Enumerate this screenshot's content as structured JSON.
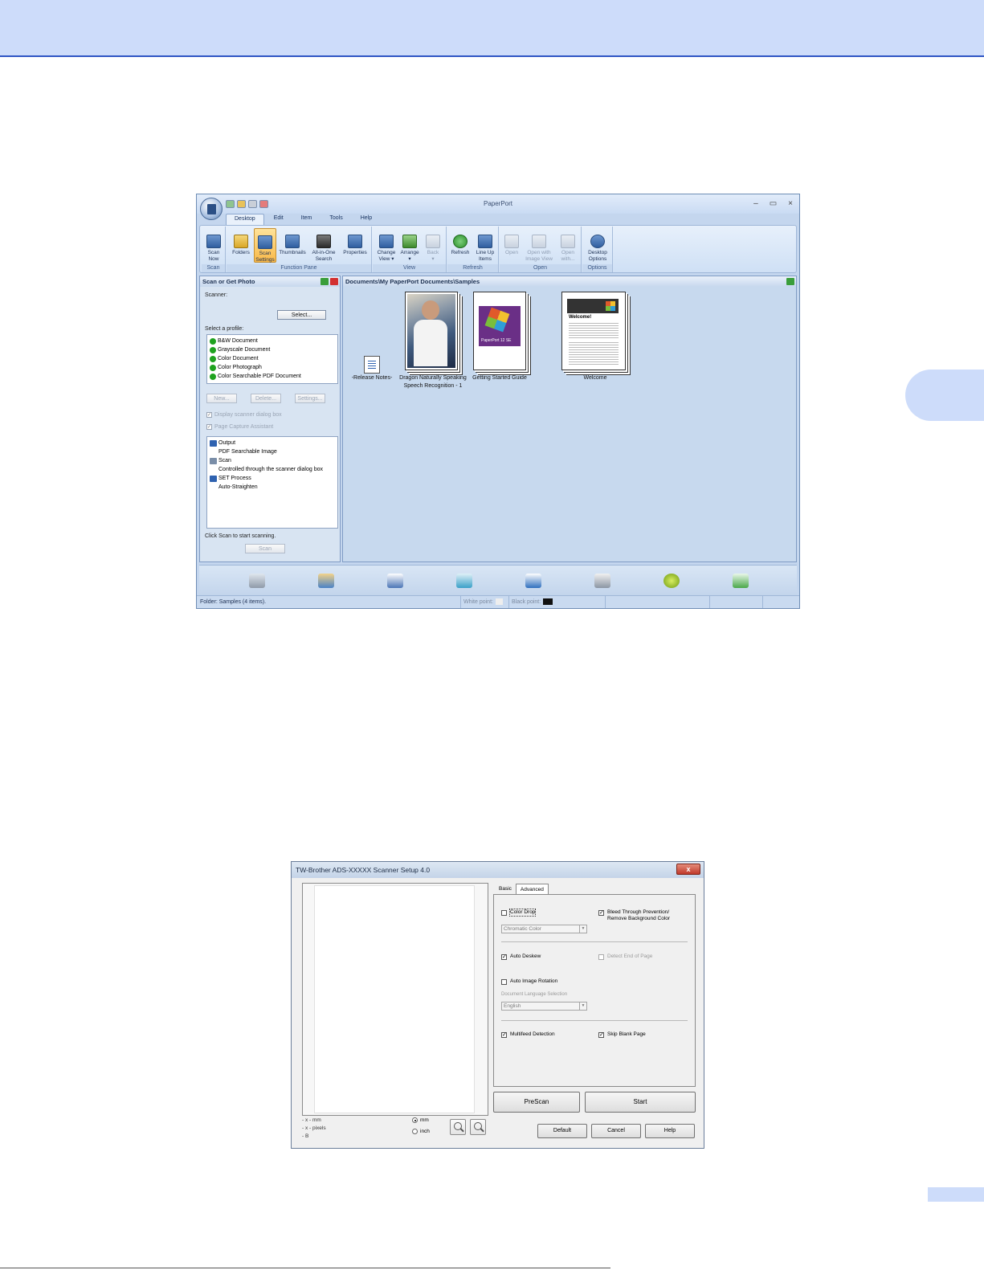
{
  "paperport": {
    "title": "PaperPort",
    "window_controls": [
      "–",
      "▭",
      "×"
    ],
    "tabs": [
      {
        "label": "Desktop",
        "active": true
      },
      {
        "label": "Edit"
      },
      {
        "label": "Item"
      },
      {
        "label": "Tools"
      },
      {
        "label": "Help"
      }
    ],
    "ribbon": {
      "scan_now": "Scan\nNow",
      "folders": "Folders",
      "scan_settings": "Scan\nSettings",
      "thumbnails": "Thumbnails",
      "all_in_one_search": "All-in-One\nSearch",
      "properties": "Properties",
      "change_view": "Change\nView ▾",
      "arrange": "Arrange\n▾",
      "back": "Back\n▾",
      "refresh": "Refresh",
      "line_up_items": "Line Up\nItems",
      "open": "Open",
      "open_with_image_view": "Open with\nImage View",
      "open_with": "Open\nwith...",
      "desktop_options": "Desktop\nOptions",
      "groups": {
        "scan": "Scan",
        "function_pane": "Function Pane",
        "view": "View",
        "refresh": "Refresh",
        "open": "Open",
        "options": "Options"
      }
    },
    "left_pane": {
      "title": "Scan or Get Photo",
      "scanner_label": "Scanner:",
      "select_button": "Select...",
      "select_profile_label": "Select a profile:",
      "profiles": [
        "B&W Document",
        "Grayscale Document",
        "Color Document",
        "Color Photograph",
        "Color Searchable PDF Document"
      ],
      "new_button": "New...",
      "delete_button": "Delete...",
      "settings_button": "Settings...",
      "display_dialog": "Display scanner dialog box",
      "page_capture": "Page Capture Assistant",
      "details": [
        {
          "text": "Output",
          "icon": "output-arrow-icon",
          "sub": false
        },
        {
          "text": "PDF Searchable Image",
          "sub": true
        },
        {
          "text": "Scan",
          "icon": "scan-icon",
          "sub": false
        },
        {
          "text": "Controlled through the scanner dialog box",
          "sub": true
        },
        {
          "text": "SET Process",
          "icon": "set-process-icon",
          "sub": false
        },
        {
          "text": "Auto-Straighten",
          "sub": true
        }
      ],
      "hint": "Click Scan to start scanning.",
      "scan_button": "Scan"
    },
    "right_pane": {
      "path": "Documents\\My PaperPort Documents\\Samples",
      "items": [
        {
          "label": "-Release Notes-"
        },
        {
          "label": "Dragon Naturally Speaking\nSpeech Recognition - 1"
        },
        {
          "label": "Getting Started Guide"
        },
        {
          "label": "Welcome"
        }
      ],
      "pp12_text": "PaperPort 12 SE",
      "welcome_heading": "Welcome!"
    },
    "sendbar_icons": [
      "scanner-send-icon",
      "paint-app-icon",
      "image-app-icon",
      "notepad-app-icon",
      "ftp-icon",
      "printer-icon",
      "hexagon-app-icon",
      "recycle-icon"
    ],
    "status": {
      "folder": "Folder: Samples (4 items).",
      "white_point": "White point:",
      "black_point": "Black point:"
    }
  },
  "scanner_dialog": {
    "title": "TW-Brother ADS-XXXXX Scanner Setup 4.0",
    "close": "x",
    "coords": [
      "- x - mm",
      "- x - pixels",
      "- B"
    ],
    "units": [
      {
        "label": "mm",
        "selected": true
      },
      {
        "label": "inch",
        "selected": false
      }
    ],
    "tabs": [
      {
        "label": "Basic"
      },
      {
        "label": "Advanced",
        "active": true
      }
    ],
    "options": {
      "color_drop": {
        "label": "Color Drop",
        "checked": false
      },
      "chromatic_color": "Chromatic Color",
      "bleed_through": {
        "label": "Bleed Through Prevention/\nRemove Background Color",
        "checked": true
      },
      "auto_deskew": {
        "label": "Auto Deskew",
        "checked": true
      },
      "detect_end_of_page": {
        "label": "Detect End of Page",
        "checked": false
      },
      "auto_image_rotation": {
        "label": "Auto Image Rotation",
        "checked": false
      },
      "document_language_label": "Document Language Selection",
      "language": "English",
      "multifeed_detection": {
        "label": "Multifeed Detection",
        "checked": true
      },
      "skip_blank_page": {
        "label": "Skip Blank Page",
        "checked": true
      }
    },
    "buttons": {
      "prescan": "PreScan",
      "start": "Start",
      "default": "Default",
      "cancel": "Cancel",
      "help": "Help"
    }
  }
}
